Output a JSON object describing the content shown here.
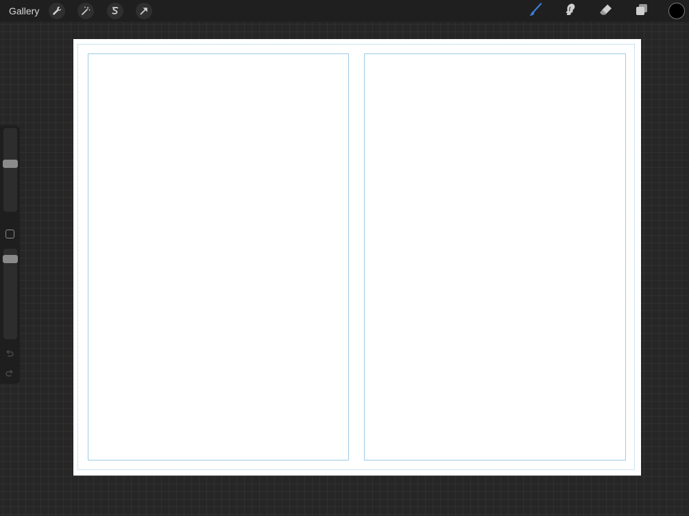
{
  "toolbar": {
    "gallery_label": "Gallery",
    "left_tools": [
      {
        "name": "actions",
        "icon": "wrench-icon"
      },
      {
        "name": "adjustments",
        "icon": "magic-wand-icon"
      },
      {
        "name": "selection",
        "icon": "selection-s-icon"
      },
      {
        "name": "transform",
        "icon": "transform-arrow-icon"
      }
    ],
    "right_tools": [
      {
        "name": "brush",
        "icon": "brush-icon",
        "active": true
      },
      {
        "name": "smudge",
        "icon": "smudge-icon",
        "active": false
      },
      {
        "name": "eraser",
        "icon": "eraser-icon",
        "active": false
      },
      {
        "name": "layers",
        "icon": "layers-icon",
        "active": false
      }
    ],
    "current_color": "#000000",
    "active_tool_color": "#3a7bd5"
  },
  "sidebar": {
    "brush_size_level": 0.42,
    "opacity_level": 0.9,
    "icons": [
      "brush-size-slider",
      "modify-button-icon",
      "opacity-slider",
      "undo-icon",
      "redo-icon"
    ]
  },
  "canvas": {
    "background": "#ffffff",
    "guide_color": "#9ccbe6",
    "panels": [
      {
        "name": "left-panel"
      },
      {
        "name": "right-panel"
      }
    ]
  }
}
